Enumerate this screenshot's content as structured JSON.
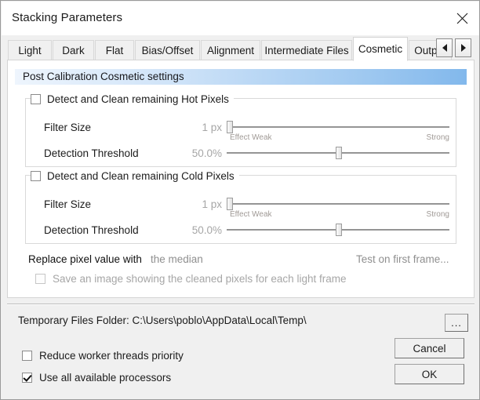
{
  "window": {
    "title": "Stacking Parameters",
    "close_icon": "close-icon"
  },
  "tabs": {
    "items": [
      {
        "label": "Light",
        "selected": false
      },
      {
        "label": "Dark",
        "selected": false
      },
      {
        "label": "Flat",
        "selected": false
      },
      {
        "label": "Bias/Offset",
        "selected": false
      },
      {
        "label": "Alignment",
        "selected": false
      },
      {
        "label": "Intermediate Files",
        "selected": false
      },
      {
        "label": "Cosmetic",
        "selected": true
      },
      {
        "label": "Output",
        "selected": false
      }
    ],
    "scroll_left_icon": "triangle-left-icon",
    "scroll_right_icon": "triangle-right-icon"
  },
  "panel": {
    "banner": "Post Calibration Cosmetic settings",
    "banner_color": "#9ec8f0",
    "hot": {
      "title": "Detect and Clean remaining Hot Pixels",
      "checked": false,
      "filter_size_label": "Filter Size",
      "filter_size_value": "1 px",
      "filter_size_percent": 0,
      "scale_min": "Effect Weak",
      "scale_max": "Strong",
      "threshold_label": "Detection Threshold",
      "threshold_value": "50.0%",
      "threshold_percent": 50
    },
    "cold": {
      "title": "Detect and Clean remaining Cold Pixels",
      "checked": false,
      "filter_size_label": "Filter Size",
      "filter_size_value": "1 px",
      "filter_size_percent": 0,
      "scale_min": "Effect Weak",
      "scale_max": "Strong",
      "threshold_label": "Detection Threshold",
      "threshold_value": "50.0%",
      "threshold_percent": 50
    },
    "replace_label": "Replace pixel value with",
    "replace_value": "the median",
    "test_link": "Test on first frame...",
    "save_image_label": "Save an image showing the cleaned pixels for each light frame",
    "save_image_checked": false,
    "save_image_disabled": true
  },
  "footer": {
    "temp_folder_text": "Temporary Files Folder:  C:\\Users\\poblo\\AppData\\Local\\Temp\\",
    "browse_label": "...",
    "reduce_priority_label": "Reduce worker threads priority",
    "reduce_priority_checked": false,
    "use_all_processors_label": "Use all available processors",
    "use_all_processors_checked": true,
    "cancel_label": "Cancel",
    "ok_label": "OK"
  }
}
